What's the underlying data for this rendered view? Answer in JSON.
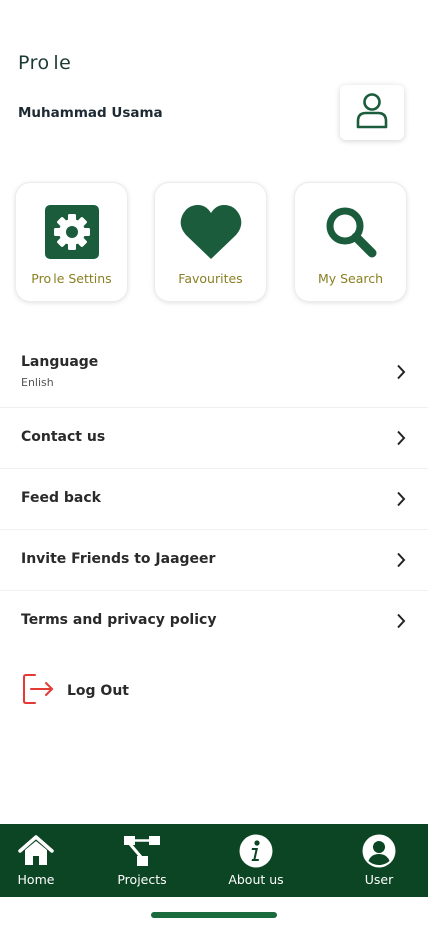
{
  "header": {
    "title": "Pro le",
    "user_name": "Muhammad Usama"
  },
  "colors": {
    "primary": "#1a5c3b",
    "nav_background": "#0b4523",
    "card_label": "#8a7f22",
    "logout_accent": "#e53935"
  },
  "quick_actions": [
    {
      "label": "Pro le Settins",
      "icon": "gear-icon"
    },
    {
      "label": "Favourites",
      "icon": "heart-icon"
    },
    {
      "label": "My Search",
      "icon": "search-icon"
    }
  ],
  "menu": {
    "language": {
      "label": "Language",
      "value": "Enlish"
    },
    "contact": {
      "label": "Contact us"
    },
    "feedback": {
      "label": "Feed back"
    },
    "invite": {
      "label": "Invite Friends to Jaageer"
    },
    "terms": {
      "label": "Terms and privacy policy"
    }
  },
  "logout": {
    "label": "Log Out",
    "icon": "logout-icon"
  },
  "bottom_nav": [
    {
      "label": "Home",
      "icon": "home-icon"
    },
    {
      "label": "Projects",
      "icon": "projects-icon"
    },
    {
      "label": "About us",
      "icon": "info-icon"
    },
    {
      "label": "User",
      "icon": "user-icon"
    }
  ]
}
